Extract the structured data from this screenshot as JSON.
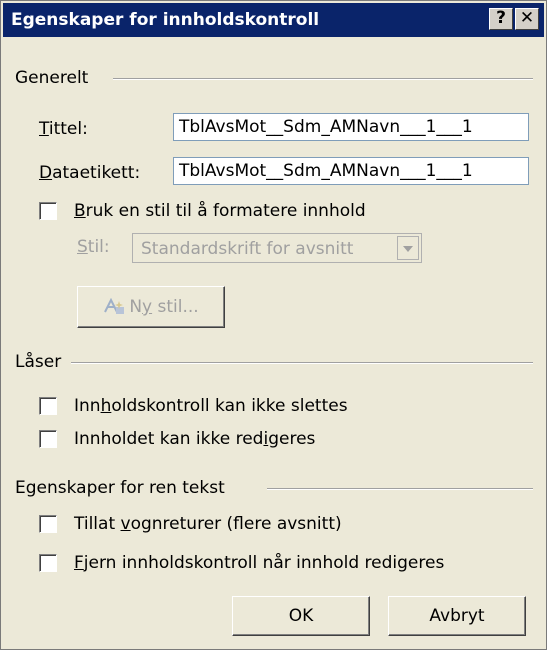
{
  "window": {
    "title": "Egenskaper for innholdskontroll",
    "help_button": "?",
    "close_button": "✕"
  },
  "general": {
    "header": "Generelt",
    "title_label": {
      "pre": "",
      "mn": "T",
      "post": "ittel:"
    },
    "title_value": "TblAvsMot__Sdm_AMNavn___1___1",
    "tag_label": {
      "pre": "",
      "mn": "D",
      "post": "ataetikett:"
    },
    "tag_value": "TblAvsMot__Sdm_AMNavn___1___1",
    "use_style": {
      "pre": "",
      "mn": "B",
      "post": "ruk en stil til å formatere innhold",
      "checked": false
    },
    "style_label": {
      "pre": "",
      "mn": "S",
      "post": "til:"
    },
    "style_value": "Standardskrift for avsnitt",
    "new_style_button": {
      "pre": "N",
      "mn": "y",
      "post": " stil..."
    }
  },
  "locking": {
    "header": "Låser",
    "cannot_delete": {
      "pre": "Inn",
      "mn": "h",
      "post": "oldskontroll kan ikke slettes",
      "checked": false
    },
    "cannot_edit": {
      "pre": "Innholdet kan ikke red",
      "mn": "i",
      "post": "geres",
      "checked": false
    }
  },
  "plain_text": {
    "header": "Egenskaper for ren tekst",
    "allow_returns": {
      "pre": "Tillat ",
      "mn": "v",
      "post": "ognreturer (flere avsnitt)",
      "checked": false
    },
    "remove_control": {
      "pre": "",
      "mn": "F",
      "post": "jern innholdskontroll når innhold redigeres",
      "checked": false
    }
  },
  "buttons": {
    "ok": "OK",
    "cancel": "Avbryt"
  },
  "colors": {
    "titlebar": "#0a246a",
    "dialog_bg": "#ece9d8",
    "disabled_text": "#a0a0a0"
  },
  "icons": {
    "new_style": "new-style-icon",
    "dropdown": "chevron-down-icon"
  }
}
